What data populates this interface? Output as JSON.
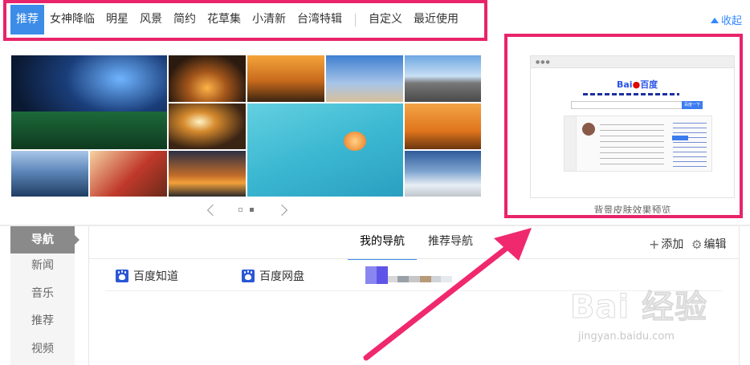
{
  "category_tabs": [
    {
      "label": "推荐",
      "active": true
    },
    {
      "label": "女神降临"
    },
    {
      "label": "明星"
    },
    {
      "label": "风景"
    },
    {
      "label": "简约"
    },
    {
      "label": "花草集"
    },
    {
      "label": "小清新"
    },
    {
      "label": "台湾特辑"
    }
  ],
  "extra_tabs": [
    {
      "label": "自定义"
    },
    {
      "label": "最近使用"
    }
  ],
  "collapse_label": "收起",
  "preview": {
    "caption": "背景皮肤效果预览",
    "logo_left": "Bai",
    "logo_right": "百度",
    "search_button": "百度一下"
  },
  "left_nav": [
    {
      "label": "导航",
      "active": true
    },
    {
      "label": "新闻"
    },
    {
      "label": "音乐"
    },
    {
      "label": "推荐"
    },
    {
      "label": "视频"
    }
  ],
  "sub_tabs": [
    {
      "label": "我的导航",
      "active": true
    },
    {
      "label": "推荐导航"
    }
  ],
  "actions": {
    "add": "添加",
    "edit": "编辑"
  },
  "nav_links": [
    {
      "label": "百度知道"
    },
    {
      "label": "百度网盘"
    }
  ],
  "watermark": {
    "main": "Bai 经验",
    "url": "jingyan.baidu.com"
  },
  "colors": {
    "accent": "#3c8ce8",
    "highlight_box": "#e8246a",
    "arrow": "#f0286e"
  }
}
